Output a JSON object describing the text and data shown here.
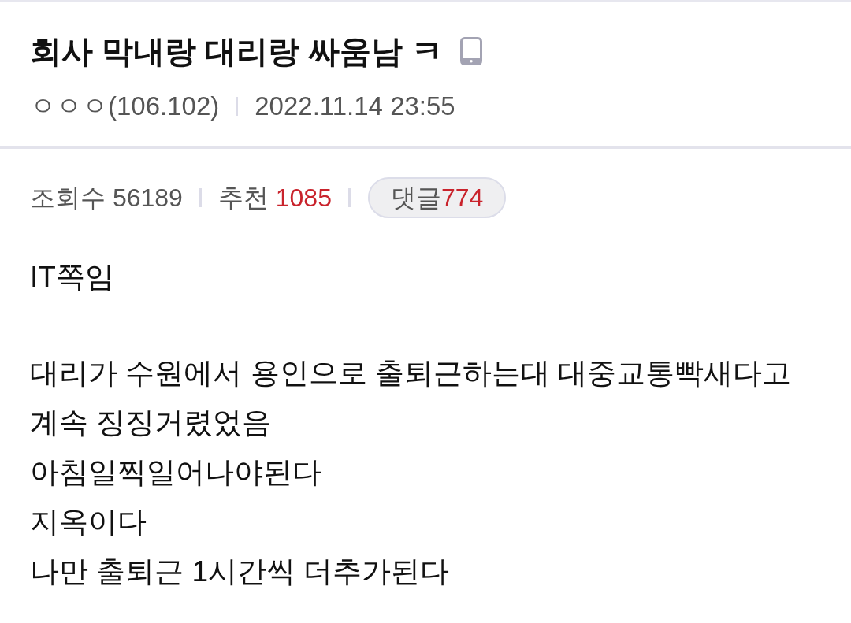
{
  "post": {
    "title": "회사 막내랑 대리랑 싸움남 ㅋ",
    "mobile_post": true,
    "author": "ㅇㅇㅇ(106.102)",
    "date": "2022.11.14 23:55",
    "stats": [
      {
        "kind": "plain",
        "label": "조회수",
        "value": "56189"
      },
      {
        "kind": "accent",
        "label": "추천",
        "value": "1085"
      },
      {
        "kind": "pill",
        "label": "댓글",
        "value": "774"
      }
    ],
    "body": {
      "paragraphs": [
        [
          "IT쪽임"
        ],
        [
          "대리가 수원에서 용인으로 출퇴근하는대 대중교통빡새다고",
          "계속 징징거렸었음",
          "아침일찍일어나야된다",
          "지옥이다",
          "나만 출퇴근 1시간씩 더추가된다"
        ]
      ]
    }
  }
}
